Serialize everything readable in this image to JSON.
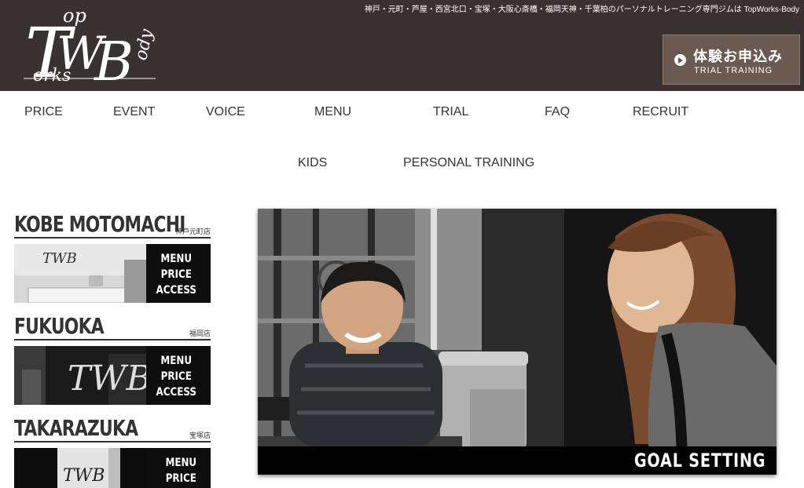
{
  "header": {
    "logo_text": "TopWorksBody",
    "tagline": "神戸・元町・芦屋・西宮北口・宝塚・大阪心斎橋・福岡天神・千葉柏のパーソナルトレーニング専門ジムは TopWorks-Body",
    "trial_button": {
      "jp": "体験お申込み",
      "en": "TRIAL TRAINING"
    }
  },
  "nav": {
    "items": [
      "PRICE",
      "EVENT",
      "VOICE",
      "MENU",
      "TRIAL",
      "FAQ",
      "RECRUIT",
      "KIDS",
      "PERSONAL TRAINING"
    ]
  },
  "stores": [
    {
      "name": "KOBE MOTOMACHI",
      "jp": "神戸元町店",
      "links": [
        "MENU",
        "PRICE",
        "ACCESS"
      ]
    },
    {
      "name": "FUKUOKA",
      "jp": "福岡店",
      "links": [
        "MENU",
        "PRICE",
        "ACCESS"
      ]
    },
    {
      "name": "TAKARAZUKA",
      "jp": "宝塚店",
      "links": [
        "MENU",
        "PRICE"
      ]
    }
  ],
  "hero": {
    "caption": "GOAL SETTING"
  },
  "colors": {
    "header_bg": "#3a3230",
    "button_bg": "#6a5a52",
    "text": "#333333"
  }
}
